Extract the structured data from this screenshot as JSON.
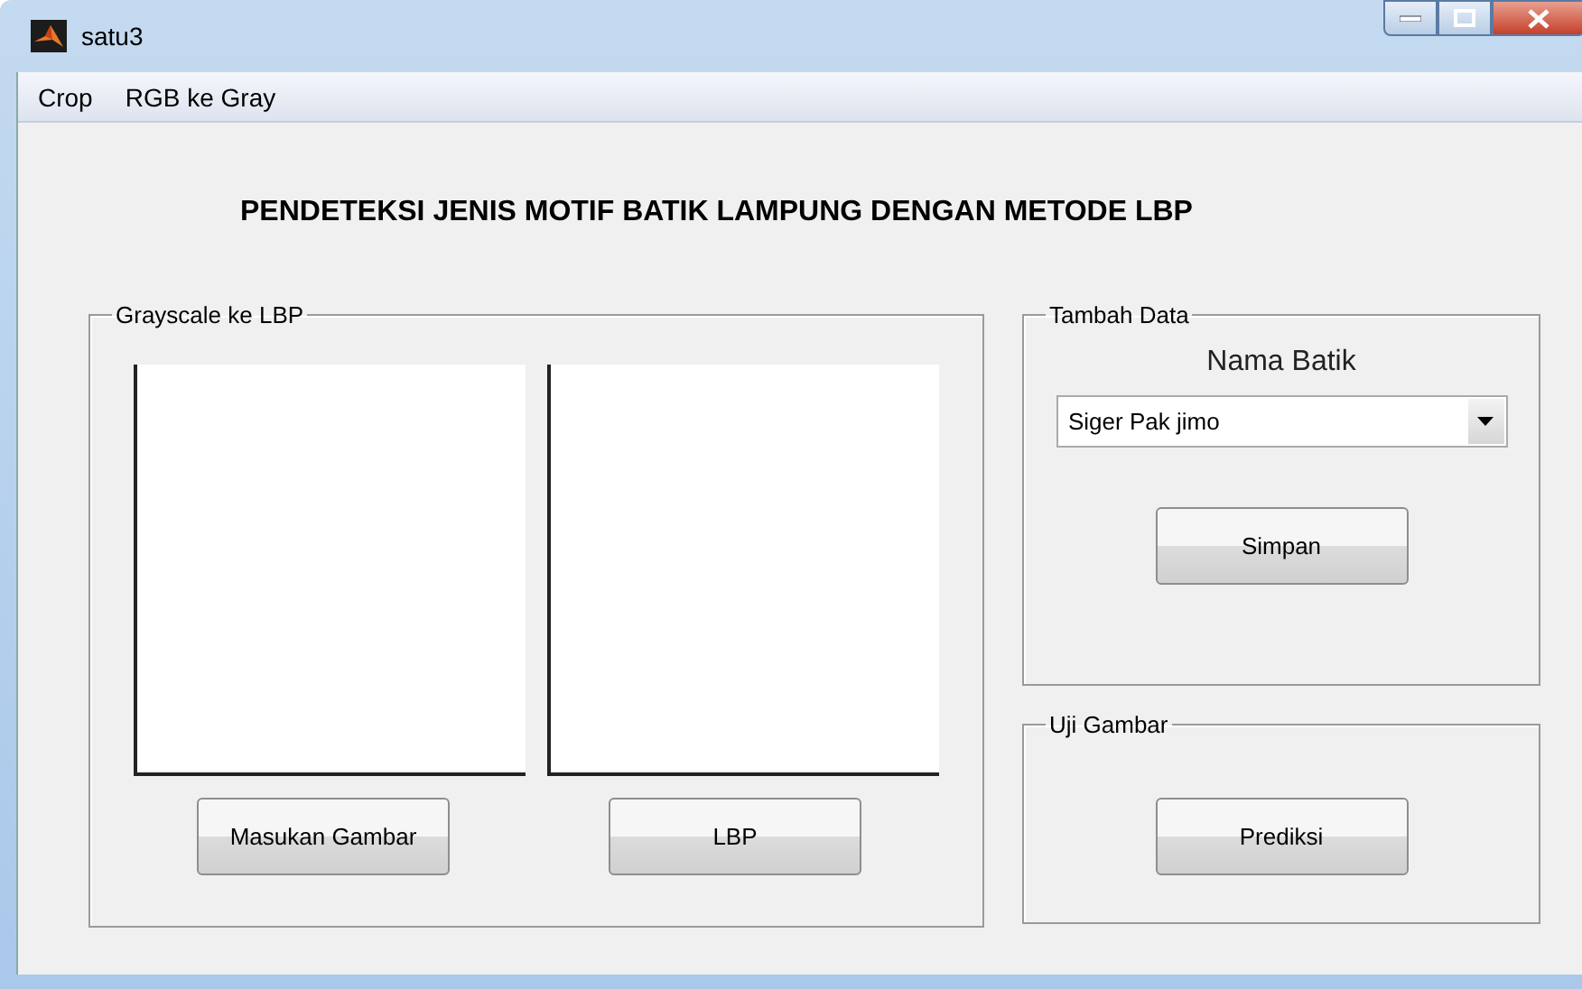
{
  "window": {
    "title": "satu3"
  },
  "menu": [
    "Crop",
    "RGB ke Gray"
  ],
  "heading": "PENDETEKSI JENIS MOTIF BATIK LAMPUNG DENGAN METODE LBP",
  "grayscale_panel": {
    "title": "Grayscale ke LBP",
    "buttons": [
      "Masukan Gambar",
      "LBP"
    ]
  },
  "tambah_panel": {
    "title": "Tambah Data",
    "label": "Nama Batik",
    "dropdown": {
      "value": "Siger Pak jimo"
    },
    "button": "Simpan"
  },
  "uji_panel": {
    "title": "Uji Gambar",
    "button": "Prediksi"
  }
}
